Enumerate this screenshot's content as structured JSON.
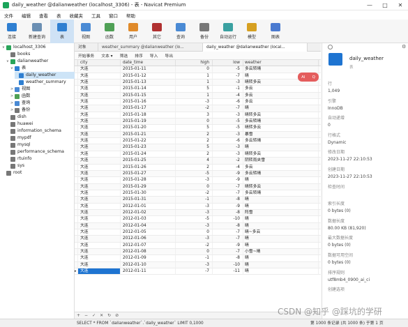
{
  "window": {
    "title": "daily_weather @dalianweather (localhost_3306) - 表 - Navicat Premium",
    "controls": [
      "—",
      "□",
      "✕"
    ]
  },
  "menu": [
    "文件",
    "编辑",
    "查看",
    "表",
    "收藏夹",
    "工具",
    "窗口",
    "帮助"
  ],
  "toolbar": [
    {
      "label": "连接",
      "icon": "plug-icon",
      "color": "#2f7fd1"
    },
    {
      "label": "新建查询",
      "icon": "new-query-icon",
      "color": "#6b8fb3"
    },
    {
      "label": "表",
      "icon": "table-icon",
      "color": "#2f7fd1"
    },
    {
      "label": "视图",
      "icon": "view-icon",
      "color": "#4a8ad4"
    },
    {
      "label": "函数",
      "icon": "function-icon",
      "color": "#4fa055"
    },
    {
      "label": "用户",
      "icon": "user-icon",
      "color": "#e08a2a"
    },
    {
      "label": "其它",
      "icon": "tools-icon",
      "color": "#b03030"
    },
    {
      "label": "查询",
      "icon": "query-icon",
      "color": "#4a8ad4"
    },
    {
      "label": "备份",
      "icon": "backup-icon",
      "color": "#777777"
    },
    {
      "label": "自动运行",
      "icon": "schedule-icon",
      "color": "#3aa0a0"
    },
    {
      "label": "模型",
      "icon": "model-icon",
      "color": "#d6a021"
    },
    {
      "label": "图表",
      "icon": "chart-icon",
      "color": "#4a7ad0"
    }
  ],
  "tree": [
    {
      "label": "localhost_3306",
      "icon": "server-icon",
      "color": "#2aa55a",
      "level": 0,
      "toggle": "∨"
    },
    {
      "label": "books",
      "icon": "database-icon",
      "color": "#777777",
      "level": 1,
      "toggle": ""
    },
    {
      "label": "dalianweather",
      "icon": "database-icon",
      "color": "#2aa55a",
      "level": 1,
      "toggle": "∨"
    },
    {
      "label": "表",
      "icon": "tables-folder-icon",
      "color": "#2f7fd1",
      "level": 2,
      "toggle": "∨"
    },
    {
      "label": "daily_weather",
      "icon": "table-icon",
      "color": "#2f7fd1",
      "level": 3,
      "toggle": "",
      "selected": true
    },
    {
      "label": "weather_summary",
      "icon": "table-icon",
      "color": "#2f7fd1",
      "level": 3,
      "toggle": ""
    },
    {
      "label": "视图",
      "icon": "views-folder-icon",
      "color": "#4a8ad4",
      "level": 2,
      "toggle": ">"
    },
    {
      "label": "函数",
      "icon": "functions-folder-icon",
      "color": "#4fa055",
      "level": 2,
      "toggle": ">"
    },
    {
      "label": "查询",
      "icon": "queries-folder-icon",
      "color": "#4a8ad4",
      "level": 2,
      "toggle": ">"
    },
    {
      "label": "备份",
      "icon": "backups-folder-icon",
      "color": "#777777",
      "level": 2,
      "toggle": ">"
    },
    {
      "label": "dish",
      "icon": "database-icon",
      "color": "#777777",
      "level": 1,
      "toggle": ""
    },
    {
      "label": "huawei",
      "icon": "database-icon",
      "color": "#777777",
      "level": 1,
      "toggle": ""
    },
    {
      "label": "information_schema",
      "icon": "database-icon",
      "color": "#777777",
      "level": 1,
      "toggle": ""
    },
    {
      "label": "mypdf",
      "icon": "database-icon",
      "color": "#777777",
      "level": 1,
      "toggle": ""
    },
    {
      "label": "mysql",
      "icon": "database-icon",
      "color": "#777777",
      "level": 1,
      "toggle": ""
    },
    {
      "label": "performance_schema",
      "icon": "database-icon",
      "color": "#777777",
      "level": 1,
      "toggle": ""
    },
    {
      "label": "rtuinfo",
      "icon": "database-icon",
      "color": "#777777",
      "level": 1,
      "toggle": ""
    },
    {
      "label": "sys",
      "icon": "database-icon",
      "color": "#777777",
      "level": 1,
      "toggle": ""
    },
    {
      "label": "root",
      "icon": "server-icon",
      "color": "#777777",
      "level": 0,
      "toggle": ""
    }
  ],
  "tabs": [
    {
      "label": "对象",
      "active": false
    },
    {
      "label": "weather_summary @dalianweather (lo...",
      "active": false
    },
    {
      "label": "daily_weather @dalianweather (local...",
      "active": true
    }
  ],
  "subtoolbar": [
    "开始事务",
    "文本 ▾",
    "筛选",
    "排序",
    "导入",
    "导出"
  ],
  "columns": [
    "city",
    "date_time",
    "high",
    "low",
    "weather"
  ],
  "rows": [
    [
      "大连",
      "2015-01-11",
      "0",
      "-5",
      "多云转晴"
    ],
    [
      "大连",
      "2015-01-12",
      "1",
      "-7",
      "晴"
    ],
    [
      "大连",
      "2015-01-13",
      "1",
      "-3",
      "晴转多云"
    ],
    [
      "大连",
      "2015-01-14",
      "5",
      "-1",
      "多云"
    ],
    [
      "大连",
      "2015-01-15",
      "1",
      "-4",
      "多云"
    ],
    [
      "大连",
      "2015-01-16",
      "-3",
      "-6",
      "多云"
    ],
    [
      "大连",
      "2015-01-17",
      "-2",
      "-7",
      "晴"
    ],
    [
      "大连",
      "2015-01-18",
      "3",
      "-3",
      "晴转多云"
    ],
    [
      "大连",
      "2015-01-19",
      "0",
      "-5",
      "多云转晴"
    ],
    [
      "大连",
      "2015-01-20",
      "5",
      "-5",
      "晴转多云"
    ],
    [
      "大连",
      "2015-01-21",
      "2",
      "-3",
      "暴雪"
    ],
    [
      "大连",
      "2015-01-22",
      "2",
      "-6",
      "多云转晴"
    ],
    [
      "大连",
      "2015-01-23",
      "5",
      "-3",
      "晴"
    ],
    [
      "大连",
      "2015-01-24",
      "2",
      "-3",
      "晴转多云"
    ],
    [
      "大连",
      "2015-01-25",
      "4",
      "-2",
      "阴转雨夹雪"
    ],
    [
      "大连",
      "2015-01-26",
      "2",
      "-4",
      "多云"
    ],
    [
      "大连",
      "2015-01-27",
      "-5",
      "-9",
      "多云转晴"
    ],
    [
      "大连",
      "2015-01-28",
      "-3",
      "-9",
      "晴"
    ],
    [
      "大连",
      "2015-01-29",
      "0",
      "-7",
      "晴转多云"
    ],
    [
      "大连",
      "2015-01-30",
      "-2",
      "-7",
      "多云转晴"
    ],
    [
      "大连",
      "2015-01-31",
      "-1",
      "-8",
      "晴"
    ],
    [
      "大连",
      "2012-01-01",
      "-3",
      "-9",
      "晴"
    ],
    [
      "大连",
      "2012-01-02",
      "-3",
      "-8",
      "阵雪"
    ],
    [
      "大连",
      "2012-01-03",
      "-5",
      "-10",
      "晴"
    ],
    [
      "大连",
      "2012-01-04",
      "-3",
      "-8",
      "晴"
    ],
    [
      "大连",
      "2012-01-05",
      "0",
      "-7",
      "晴~多云"
    ],
    [
      "大连",
      "2012-01-06",
      "-3",
      "-7",
      "晴"
    ],
    [
      "大连",
      "2012-01-07",
      "-2",
      "-9",
      "晴"
    ],
    [
      "大连",
      "2012-01-08",
      "0",
      "-7",
      "小雪~晴"
    ],
    [
      "大连",
      "2012-01-09",
      "-1",
      "-8",
      "晴"
    ],
    [
      "大连",
      "2012-01-10",
      "-3",
      "-10",
      "晴"
    ],
    [
      "大连",
      "2012-01-11",
      "-7",
      "-11",
      "晴"
    ]
  ],
  "selected_row_index": 31,
  "float_buttons": [
    "AI",
    "Q"
  ],
  "bottom_nav": [
    "+",
    "−",
    "✓",
    "✕",
    "↻",
    "⊘"
  ],
  "status": {
    "sql": "SELECT * FROM `dalianweather`.`daily_weather` LIMIT 0,1000",
    "records": "第 1000 条记录 (共 1000 条) 于第 1 页"
  },
  "watermark": "CSDN @知乎 @踩坑的学研",
  "right_panel": {
    "title": "daily_weather",
    "subtitle": "表",
    "items": [
      {
        "key": "行",
        "value": "1,049"
      },
      {
        "key": "引擎",
        "value": "InnoDB"
      },
      {
        "key": "自动递增",
        "value": "0"
      },
      {
        "key": "行格式",
        "value": "Dynamic"
      },
      {
        "key": "修改日期",
        "value": "2023-11-27 22:10:53"
      },
      {
        "key": "创建日期",
        "value": "2023-11-27 22:10:53"
      },
      {
        "key": "检查时间",
        "value": ""
      },
      {
        "key": "索引长度",
        "value": "0 bytes (0)"
      },
      {
        "key": "数据长度",
        "value": "80.00 KB (81,920)"
      },
      {
        "key": "最大数据长度",
        "value": "0 bytes (0)"
      },
      {
        "key": "数据可用空间",
        "value": "0 bytes (0)"
      },
      {
        "key": "排序规则",
        "value": "utf8mb4_0900_ai_ci"
      },
      {
        "key": "创建选项",
        "value": ""
      }
    ]
  }
}
